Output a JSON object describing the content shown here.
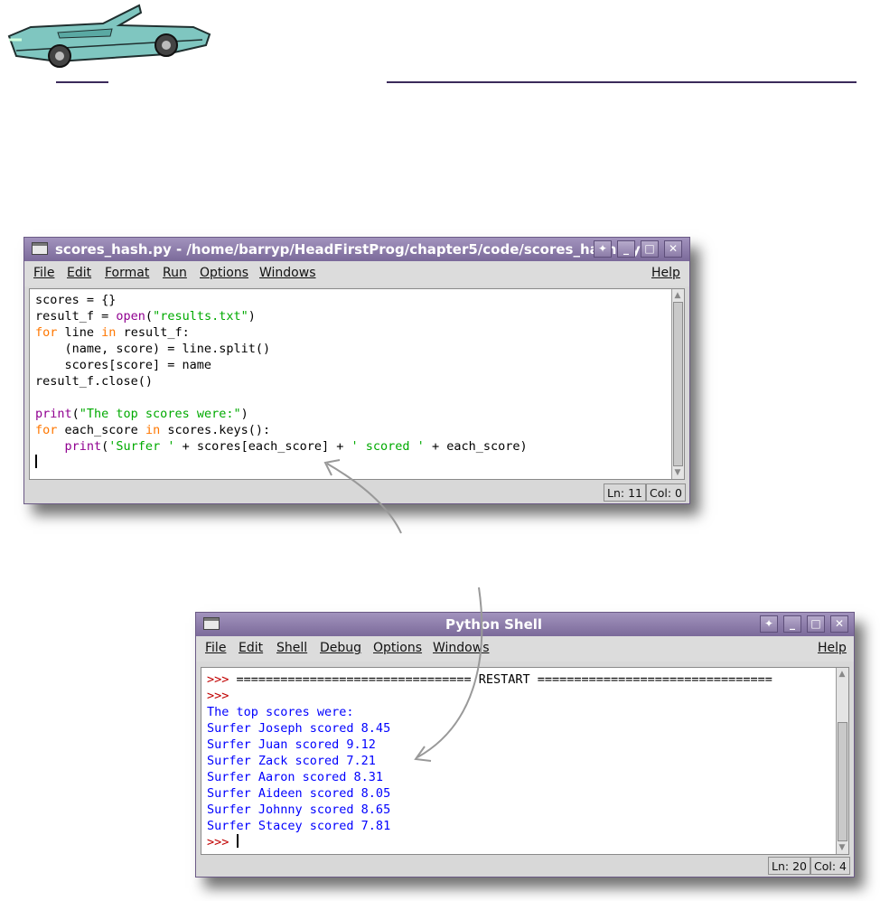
{
  "editor_window": {
    "title": "scores_hash.py - /home/barryp/HeadFirstProg/chapter5/code/scores_hash.py",
    "menu": [
      "File",
      "Edit",
      "Format",
      "Run",
      "Options",
      "Windows"
    ],
    "help": "Help",
    "code_lines": [
      [
        {
          "t": "scores = {}",
          "c": ""
        }
      ],
      [
        {
          "t": "result_f = ",
          "c": ""
        },
        {
          "t": "open",
          "c": "bi"
        },
        {
          "t": "(",
          "c": ""
        },
        {
          "t": "\"results.txt\"",
          "c": "str"
        },
        {
          "t": ")",
          "c": ""
        }
      ],
      [
        {
          "t": "for",
          "c": "kw"
        },
        {
          "t": " line ",
          "c": ""
        },
        {
          "t": "in",
          "c": "kw"
        },
        {
          "t": " result_f:",
          "c": ""
        }
      ],
      [
        {
          "t": "    (name, score) = line.split()",
          "c": ""
        }
      ],
      [
        {
          "t": "    scores[score] = name",
          "c": ""
        }
      ],
      [
        {
          "t": "result_f.close()",
          "c": ""
        }
      ],
      [
        {
          "t": "",
          "c": ""
        }
      ],
      [
        {
          "t": "print",
          "c": "bi"
        },
        {
          "t": "(",
          "c": ""
        },
        {
          "t": "\"The top scores were:\"",
          "c": "str"
        },
        {
          "t": ")",
          "c": ""
        }
      ],
      [
        {
          "t": "for",
          "c": "kw"
        },
        {
          "t": " each_score ",
          "c": ""
        },
        {
          "t": "in",
          "c": "kw"
        },
        {
          "t": " scores.keys():",
          "c": ""
        }
      ],
      [
        {
          "t": "    ",
          "c": ""
        },
        {
          "t": "print",
          "c": "bi"
        },
        {
          "t": "(",
          "c": ""
        },
        {
          "t": "'Surfer '",
          "c": "str"
        },
        {
          "t": " + scores[each_score] + ",
          "c": ""
        },
        {
          "t": "' scored '",
          "c": "str"
        },
        {
          "t": " + each_score)",
          "c": ""
        }
      ],
      [
        {
          "t": "",
          "c": "caret"
        }
      ]
    ],
    "status": {
      "line": "Ln: 11",
      "col": "Col: 0"
    }
  },
  "shell_window": {
    "title": "Python Shell",
    "menu": [
      "File",
      "Edit",
      "Shell",
      "Debug",
      "Options",
      "Windows"
    ],
    "help": "Help",
    "code_lines": [
      [
        {
          "t": ">>> ",
          "c": "prm"
        },
        {
          "t": "================================ RESTART ================================",
          "c": ""
        }
      ],
      [
        {
          "t": ">>> ",
          "c": "prm"
        }
      ],
      [
        {
          "t": "The top scores were:",
          "c": "out"
        }
      ],
      [
        {
          "t": "Surfer Joseph scored 8.45",
          "c": "out"
        }
      ],
      [
        {
          "t": "Surfer Juan scored 9.12",
          "c": "out"
        }
      ],
      [
        {
          "t": "Surfer Zack scored 7.21",
          "c": "out"
        }
      ],
      [
        {
          "t": "Surfer Aaron scored 8.31",
          "c": "out"
        }
      ],
      [
        {
          "t": "Surfer Aideen scored 8.05",
          "c": "out"
        }
      ],
      [
        {
          "t": "Surfer Johnny scored 8.65",
          "c": "out"
        }
      ],
      [
        {
          "t": "Surfer Stacey scored 7.81",
          "c": "out"
        }
      ],
      [
        {
          "t": ">>> ",
          "c": "prm"
        },
        {
          "t": "",
          "c": "caret"
        }
      ]
    ],
    "status": {
      "line": "Ln: 20",
      "col": "Col: 4"
    }
  },
  "colors": {
    "titlebar": "#8b7aa8",
    "keyword": "#ff7700",
    "builtin": "#900090",
    "string": "#00aa00",
    "output": "#0000ff",
    "prompt": "#c00000"
  }
}
